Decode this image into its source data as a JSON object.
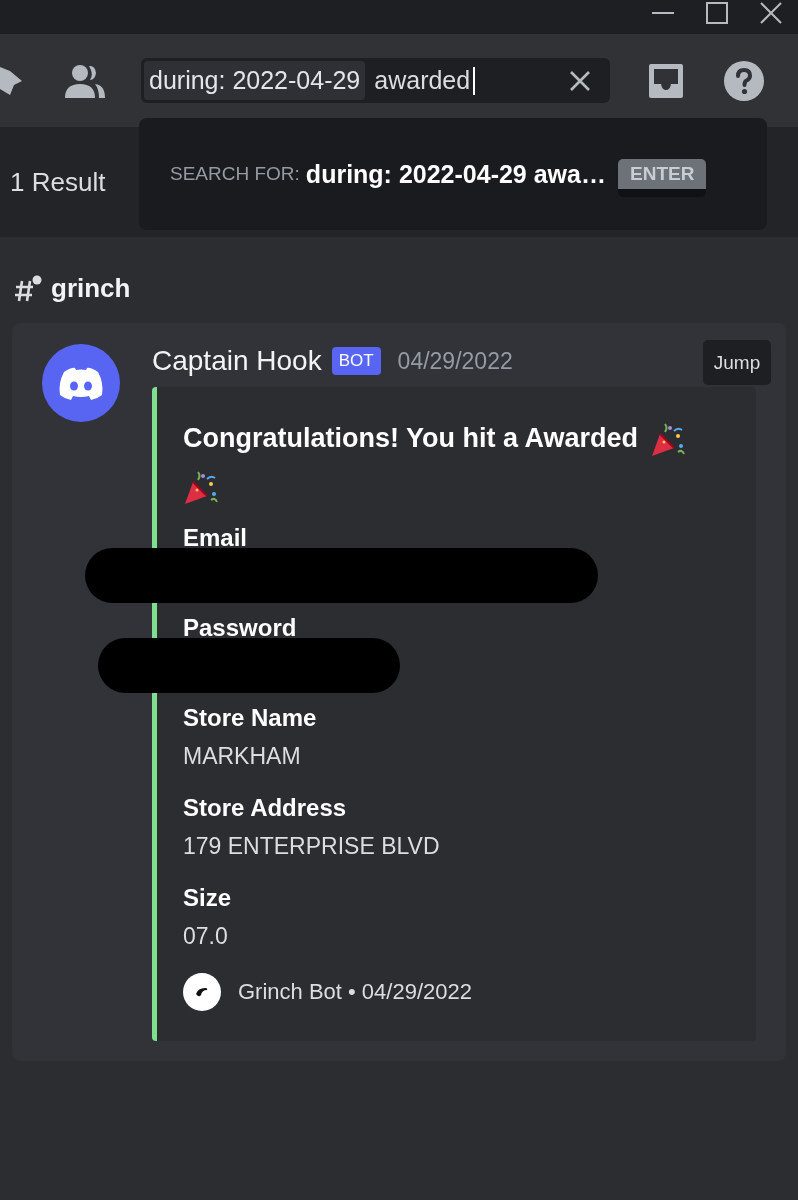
{
  "toolbar": {
    "search": {
      "filter": "during: 2022-04-29",
      "value": "awarded"
    }
  },
  "search_popout": {
    "label": "SEARCH FOR:",
    "query": "during: 2022-04-29 awa…",
    "key_hint": "ENTER"
  },
  "results": {
    "count": "1 Result",
    "channel": "grinch",
    "messages": [
      {
        "author": "Captain Hook",
        "badge": "BOT",
        "timestamp": "04/29/2022",
        "jump": "Jump",
        "embed": {
          "title": "Congratulations! You hit a Awarded",
          "fields": [
            {
              "name": "Email",
              "redacted": true
            },
            {
              "name": "Password",
              "redacted": true
            },
            {
              "name": "Store Name",
              "value": "MARKHAM",
              "redacted": false
            },
            {
              "name": "Store Address",
              "value": "179 ENTERPRISE BLVD",
              "redacted": false
            },
            {
              "name": "Size",
              "value": "07.0",
              "redacted": false
            }
          ],
          "footer": "Grinch Bot • 04/29/2022"
        }
      }
    ]
  }
}
